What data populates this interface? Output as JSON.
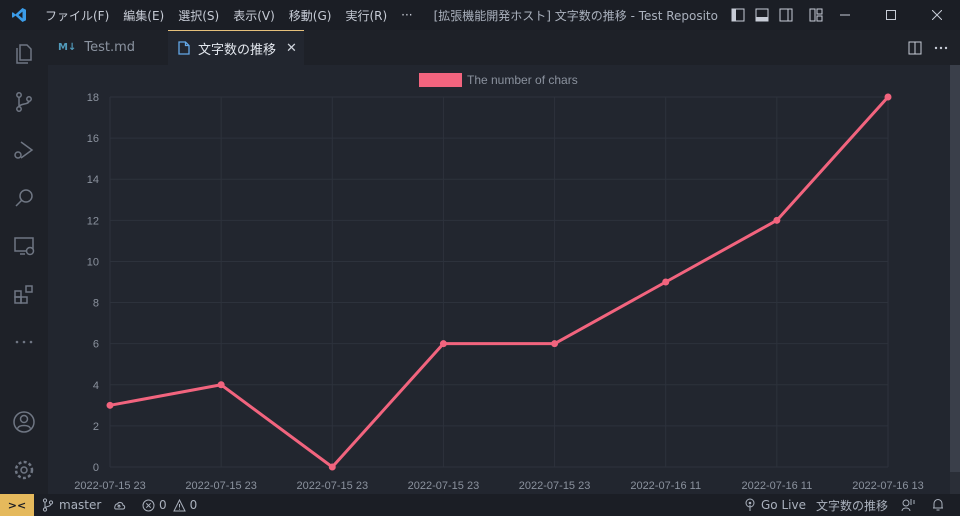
{
  "titlebar": {
    "menu": [
      "ファイル(F)",
      "編集(E)",
      "選択(S)",
      "表示(V)",
      "移動(G)",
      "実行(R)",
      "···"
    ],
    "window_title": "[拡張機能開発ホスト] 文字数の推移 - Test Repository ..."
  },
  "tabs": [
    {
      "icon": "M↓",
      "label": "Test.md"
    },
    {
      "label": "文字数の推移",
      "close": "✕"
    }
  ],
  "statusbar": {
    "branch": "master",
    "errors": "0",
    "warnings": "0",
    "golive": "Go Live",
    "view": "文字数の推移"
  },
  "colors": {
    "accent_line": "#f2647e",
    "remote_bg": "#e5b95c"
  },
  "chart_data": {
    "type": "line",
    "legend": "The number of chars",
    "legend_position": "top",
    "x": [
      "2022-07-15 23",
      "2022-07-15 23",
      "2022-07-15 23",
      "2022-07-15 23",
      "2022-07-15 23",
      "2022-07-16 11",
      "2022-07-16 11",
      "2022-07-16 13"
    ],
    "series": [
      {
        "name": "The number of chars",
        "values": [
          3,
          4,
          0,
          6,
          6,
          9,
          12,
          18
        ]
      }
    ],
    "ylim": [
      0,
      18
    ],
    "yticks": [
      0,
      2,
      4,
      6,
      8,
      10,
      12,
      14,
      16,
      18
    ],
    "grid": true
  }
}
